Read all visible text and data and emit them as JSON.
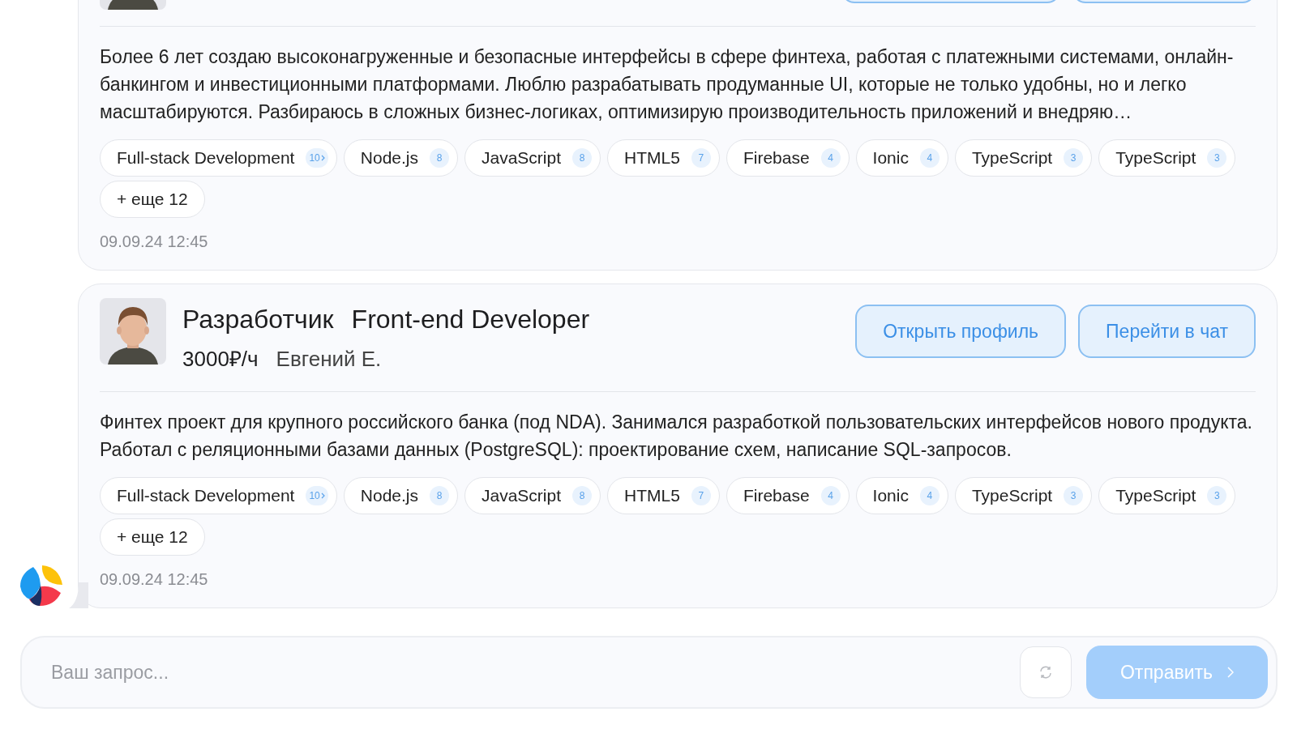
{
  "messages": [
    {
      "description": "Более 6 лет создаю высоконагруженные и безопасные интерфейсы в сфере финтеха, работая с платежными системами, онлайн-банкингом и инвестиционными платформами. Люблю разрабатывать продуманные UI, которые не только удобны, но и легко масштабируются. Разбираюсь в сложных бизнес-логиках, оптимизирую производительность приложений и внедряю…",
      "skills": [
        {
          "label": "Full-stack Development",
          "count": "10",
          "expandable": true
        },
        {
          "label": "Node.js",
          "count": "8",
          "expandable": false
        },
        {
          "label": "JavaScript",
          "count": "8",
          "expandable": false
        },
        {
          "label": "HTML5",
          "count": "7",
          "expandable": false
        },
        {
          "label": "Firebase",
          "count": "4",
          "expandable": false
        },
        {
          "label": "Ionic",
          "count": "4",
          "expandable": false
        },
        {
          "label": "TypeScript",
          "count": "3",
          "expandable": false
        },
        {
          "label": "TypeScript",
          "count": "3",
          "expandable": false
        }
      ],
      "more": "+ еще 12",
      "time": "09.09.24 12:45"
    },
    {
      "role": "Разработчик",
      "title": "Front-end Developer",
      "rate": "3000₽/ч",
      "name": "Евгений Е.",
      "buttons": [
        "Открыть профиль",
        "Перейти в чат"
      ],
      "description": "Финтех проект для крупного российского банка (под NDA). Занимался разработкой пользовательских интерфейсов нового продукта. Работал с реляционными базами данных (PostgreSQL): проектирование схем, написание SQL-запросов.",
      "skills": [
        {
          "label": "Full-stack Development",
          "count": "10",
          "expandable": true
        },
        {
          "label": "Node.js",
          "count": "8",
          "expandable": false
        },
        {
          "label": "JavaScript",
          "count": "8",
          "expandable": false
        },
        {
          "label": "HTML5",
          "count": "7",
          "expandable": false
        },
        {
          "label": "Firebase",
          "count": "4",
          "expandable": false
        },
        {
          "label": "Ionic",
          "count": "4",
          "expandable": false
        },
        {
          "label": "TypeScript",
          "count": "3",
          "expandable": false
        },
        {
          "label": "TypeScript",
          "count": "3",
          "expandable": false
        }
      ],
      "more": "+ еще 12",
      "time": "09.09.24 12:45"
    }
  ],
  "composer": {
    "placeholder": "Ваш запрос...",
    "send": {
      "label": "Отправить",
      "disabled": true
    }
  }
}
